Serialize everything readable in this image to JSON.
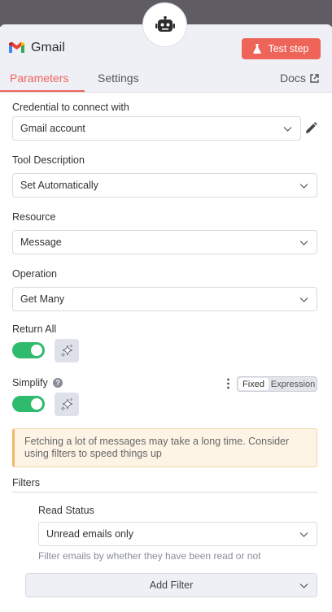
{
  "node": {
    "title": "Gmail",
    "test_step_label": "Test step"
  },
  "tabs": {
    "parameters": "Parameters",
    "settings": "Settings",
    "docs": "Docs"
  },
  "fields": {
    "credential": {
      "label": "Credential to connect with",
      "value": "Gmail account"
    },
    "tool_description": {
      "label": "Tool Description",
      "value": "Set Automatically"
    },
    "resource": {
      "label": "Resource",
      "value": "Message"
    },
    "operation": {
      "label": "Operation",
      "value": "Get Many"
    },
    "return_all": {
      "label": "Return All",
      "enabled": true
    },
    "simplify": {
      "label": "Simplify",
      "help_icon": "?",
      "enabled": true,
      "mode_fixed": "Fixed",
      "mode_expression": "Expression",
      "selected_mode": "Fixed"
    }
  },
  "notice": {
    "line1": "Fetching a lot of messages may take a long time. Consider",
    "line2": "using filters to speed things up"
  },
  "filters": {
    "label": "Filters",
    "read_status": {
      "label": "Read Status",
      "value": "Unread emails only",
      "hint": "Filter emails by whether they have been read or not"
    },
    "add_filter_label": "Add Filter"
  },
  "colors": {
    "accent": "#ef6459",
    "toggle_on": "#2fbb6e",
    "notice_bg": "#fdf4e6"
  },
  "icons": [
    "robot-icon",
    "gmail-icon",
    "flask-icon",
    "external-link-icon",
    "chevron-down-icon",
    "pencil-icon",
    "sparkle-icon",
    "help-icon",
    "kebab-menu-icon"
  ]
}
